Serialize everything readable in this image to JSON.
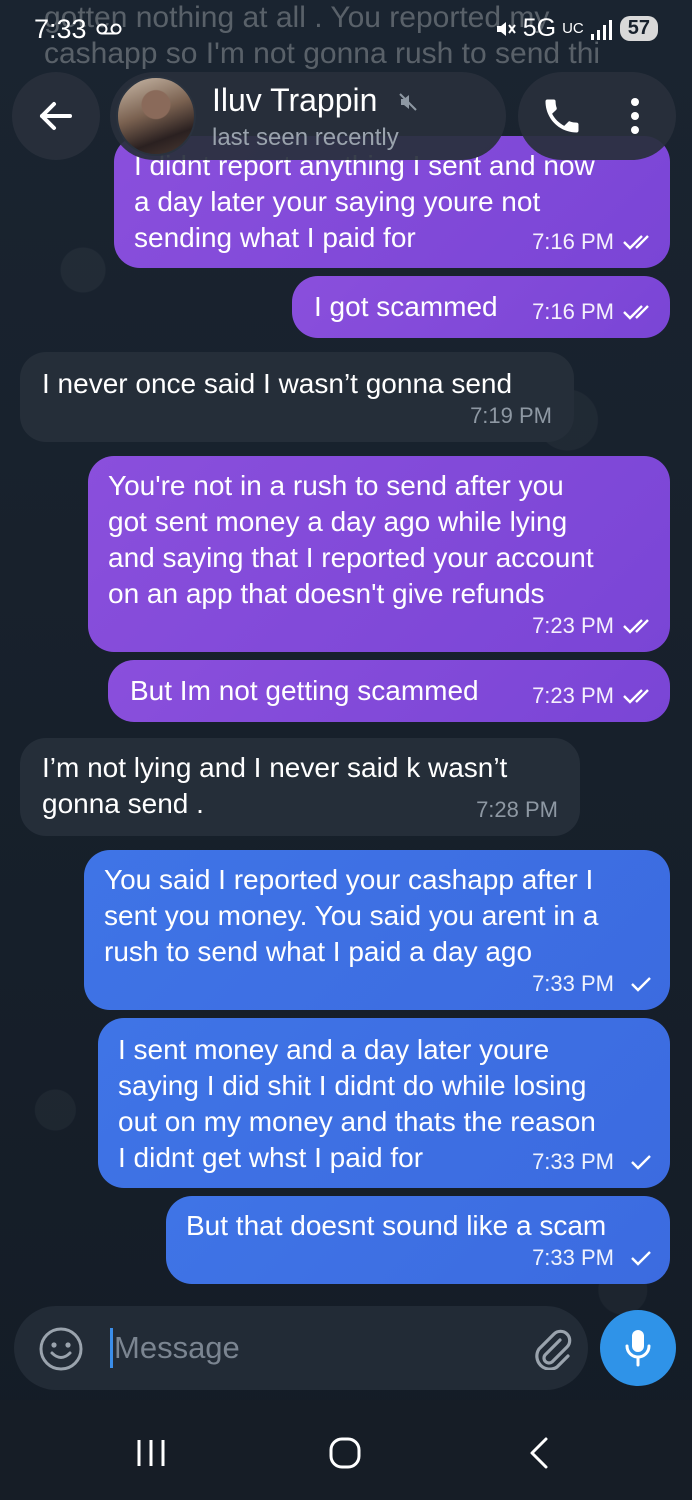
{
  "status_bar": {
    "time": "7:33",
    "network": "5G",
    "network_sub": "UC",
    "battery": "57"
  },
  "ghost_message": "gotten nothing at all . You reported my cashapp so I'm not gonna rush to send thi",
  "header": {
    "contact_name": "Iluv Trappin",
    "last_seen": "last seen recently"
  },
  "messages": [
    {
      "text": "I didnt report anything I sent and now\na day later your saying youre  not\nsending what I paid for",
      "time": "7:16 PM",
      "status": "read"
    },
    {
      "text": "I got scammed",
      "time": "7:16 PM",
      "status": "read"
    },
    {
      "text": "I never once said I wasn’t gonna send",
      "time": "7:19 PM"
    },
    {
      "text": "You're not in a rush to send after you\ngot sent money a day ago while lying\nand saying that I reported your account\non an app that doesn't give refunds",
      "time": "7:23 PM",
      "status": "read"
    },
    {
      "text": "But Im not getting scammed",
      "time": "7:23 PM",
      "status": "read"
    },
    {
      "text": "I’m not lying and I never said k wasn’t\ngonna send .",
      "time": "7:28 PM"
    },
    {
      "text": "You said I reported your cashapp after I\nsent you money. You said you arent in a\nrush to send what I paid a day ago",
      "time": "7:33 PM",
      "status": "sent"
    },
    {
      "text": "I sent money and a day later youre\nsaying I did shit I didnt do while losing\nout on my money and thats the reason\nI didnt get whst I paid for",
      "time": "7:33 PM",
      "status": "sent"
    },
    {
      "text": "But that doesnt sound like a scam",
      "time": "7:33 PM",
      "status": "sent"
    }
  ],
  "composer": {
    "placeholder": "Message"
  },
  "colors": {
    "outgoing_purple": "#8a4fdc",
    "outgoing_blue": "#3f74e6",
    "incoming": "#252e39",
    "mic_button": "#2f93e8"
  }
}
